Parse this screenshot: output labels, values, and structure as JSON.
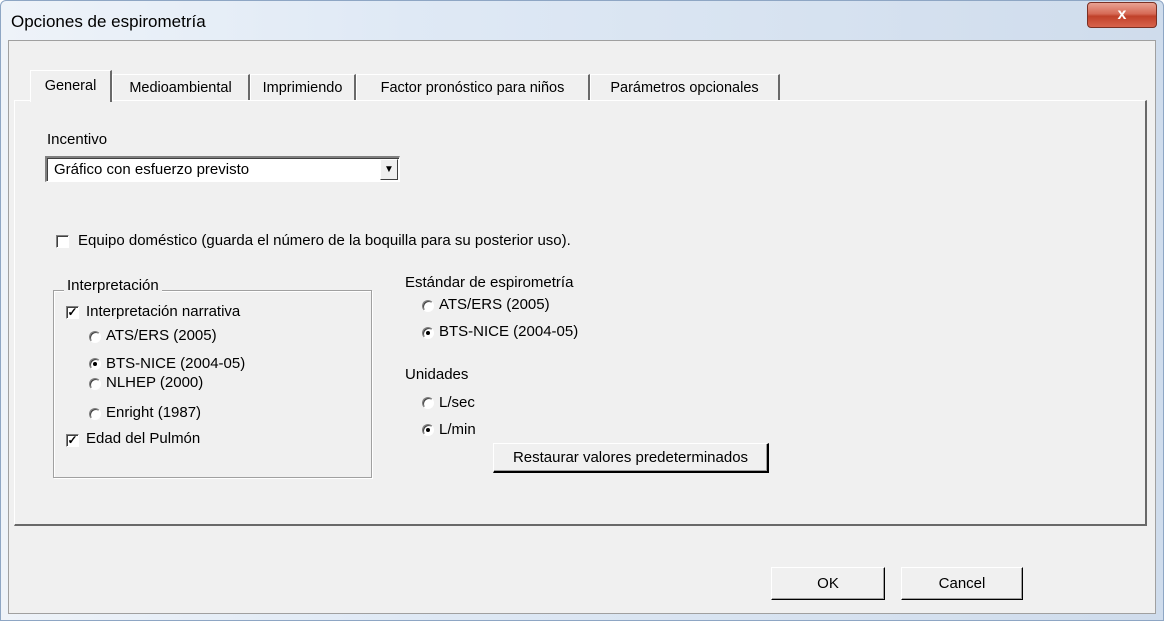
{
  "window": {
    "title": "Opciones de espirometría",
    "close_label": "x"
  },
  "tabs": [
    {
      "label": "General"
    },
    {
      "label": "Medioambiental"
    },
    {
      "label": "Imprimiendo"
    },
    {
      "label": "Factor pronóstico para niños"
    },
    {
      "label": "Parámetros opcionales"
    }
  ],
  "incentive": {
    "label": "Incentivo",
    "selected": "Gráfico con esfuerzo previsto"
  },
  "home_equipment": {
    "label": "Equipo doméstico (guarda el número de la boquilla para su posterior uso).",
    "checked": false
  },
  "interpretation": {
    "group_title": "Interpretación",
    "narrative_label": "Interpretación narrativa",
    "narrative_checked": true,
    "options": [
      {
        "label": "ATS/ERS (2005)",
        "selected": false
      },
      {
        "label": "BTS-NICE (2004-05)",
        "selected": true
      },
      {
        "label": "NLHEP (2000)",
        "selected": false
      },
      {
        "label": "Enright (1987)",
        "selected": false
      }
    ],
    "lung_age_label": "Edad del Pulmón",
    "lung_age_checked": true
  },
  "standard": {
    "label": "Estándar de espirometría",
    "options": [
      {
        "label": "ATS/ERS (2005)",
        "selected": false
      },
      {
        "label": "BTS-NICE (2004-05)",
        "selected": true
      }
    ]
  },
  "units": {
    "label": "Unidades",
    "options": [
      {
        "label": "L/sec",
        "selected": false
      },
      {
        "label": "L/min",
        "selected": true
      }
    ]
  },
  "buttons": {
    "restore_label": "Restaurar valores predeterminados",
    "ok_label": "OK",
    "cancel_label": "Cancel"
  }
}
